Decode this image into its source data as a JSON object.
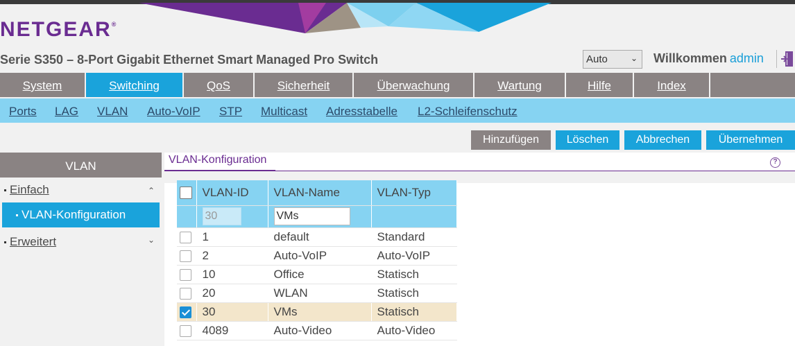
{
  "brand": {
    "logo_text": "NETGEAR",
    "logo_mark": "®",
    "purple": "#6a2c91",
    "blue": "#1aa3db",
    "light_blue": "#86d3f2",
    "gray": "#8a8383"
  },
  "header": {
    "device_title": "Serie S350 – 8-Port Gigabit Ethernet Smart Managed Pro Switch",
    "lang_select_value": "Auto",
    "welcome_label": "Willkommen",
    "user": "admin",
    "logout_icon": "logout-icon"
  },
  "main_nav": [
    {
      "label": "System",
      "active": false
    },
    {
      "label": "Switching",
      "active": true
    },
    {
      "label": "QoS",
      "active": false
    },
    {
      "label": "Sicherheit",
      "active": false
    },
    {
      "label": "Überwachung",
      "active": false
    },
    {
      "label": "Wartung",
      "active": false
    },
    {
      "label": "Hilfe",
      "active": false
    },
    {
      "label": "Index",
      "active": false
    }
  ],
  "sub_nav": [
    {
      "label": "Ports"
    },
    {
      "label": "LAG"
    },
    {
      "label": "VLAN",
      "active": true
    },
    {
      "label": "Auto-VoIP"
    },
    {
      "label": "STP"
    },
    {
      "label": "Multicast"
    },
    {
      "label": "Adresstabelle"
    },
    {
      "label": "L2-Schleifenschutz"
    }
  ],
  "actions": {
    "add": "Hinzufügen",
    "delete": "Löschen",
    "cancel": "Abbrechen",
    "apply": "Übernehmen"
  },
  "sidebar": {
    "title": "VLAN",
    "groups": [
      {
        "label": "Einfach",
        "expanded": true,
        "items": [
          {
            "label": "VLAN-Konfiguration",
            "active": true
          }
        ]
      },
      {
        "label": "Erweitert",
        "expanded": false
      }
    ]
  },
  "panel": {
    "title": "VLAN-Konfiguration",
    "help_icon": "help-icon"
  },
  "table": {
    "headers": [
      "VLAN-ID",
      "VLAN-Name",
      "VLAN-Typ"
    ],
    "edit_row": {
      "id": "30",
      "name": "VMs"
    },
    "rows": [
      {
        "id": "1",
        "name": "default",
        "type": "Standard",
        "checked": false
      },
      {
        "id": "2",
        "name": "Auto-VoIP",
        "type": "Auto-VoIP",
        "checked": false
      },
      {
        "id": "10",
        "name": "Office",
        "type": "Statisch",
        "checked": false
      },
      {
        "id": "20",
        "name": "WLAN",
        "type": "Statisch",
        "checked": false
      },
      {
        "id": "30",
        "name": "VMs",
        "type": "Statisch",
        "checked": true
      },
      {
        "id": "4089",
        "name": "Auto-Video",
        "type": "Auto-Video",
        "checked": false
      }
    ]
  }
}
